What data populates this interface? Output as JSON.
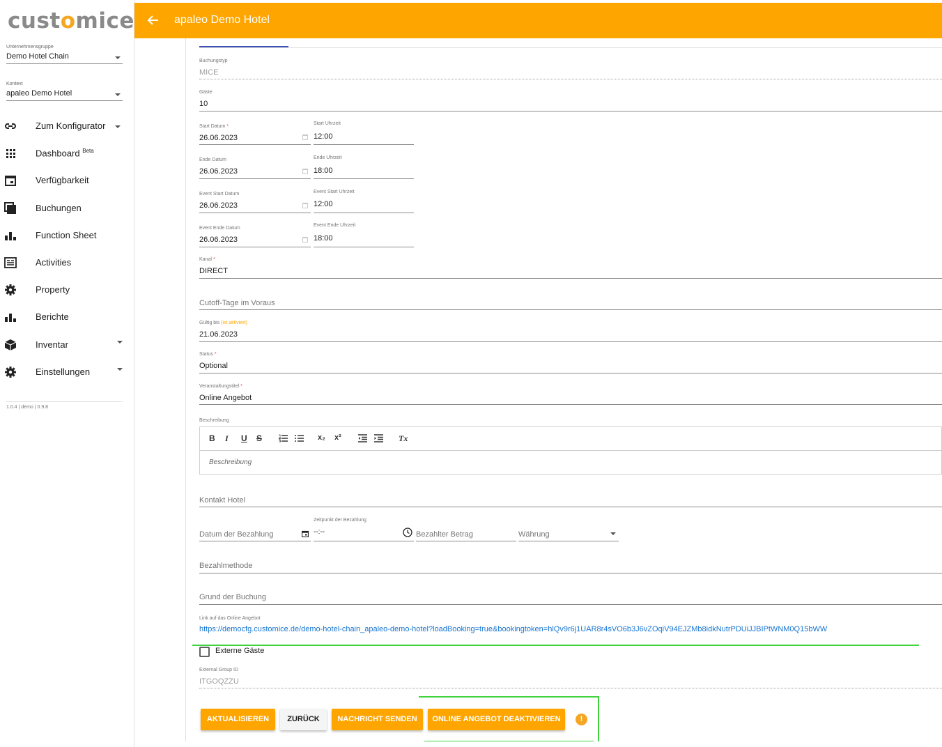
{
  "sidebar": {
    "logo_left": "cust",
    "logo_accent": "o",
    "logo_right": "mice",
    "company_group": {
      "label": "Unternehmensgruppe",
      "value": "Demo Hotel Chain"
    },
    "context": {
      "label": "Kontext",
      "value": "apaleo Demo Hotel"
    },
    "nav": [
      {
        "label": "Zum Konfigurator",
        "icon": "link-icon",
        "has_caret": true
      },
      {
        "label": "Dashboard",
        "sup": "Beta",
        "icon": "grid-icon"
      },
      {
        "label": "Verfügbarkeit",
        "icon": "calendar-icon"
      },
      {
        "label": "Buchungen",
        "icon": "stack-icon"
      },
      {
        "label": "Function Sheet",
        "icon": "bar-chart-icon"
      },
      {
        "label": "Activities",
        "icon": "newspaper-icon"
      },
      {
        "label": "Property",
        "icon": "gear-icon"
      },
      {
        "label": "Berichte",
        "icon": "bar-chart-icon"
      },
      {
        "label": "Inventar",
        "icon": "cube-icon",
        "has_caret": true
      },
      {
        "label": "Einstellungen",
        "icon": "gear-icon",
        "has_caret": true
      }
    ],
    "version": "1.0.4 | demo | 0.9.8"
  },
  "header": {
    "title": "apaleo Demo Hotel"
  },
  "form": {
    "buchungstyp": {
      "label": "Buchungstyp",
      "value": "MICE"
    },
    "gaeste": {
      "label": "Gäste",
      "value": "10"
    },
    "start_datum": {
      "label": "Start Datum",
      "value": "26.06.2023"
    },
    "start_uhrzeit": {
      "label": "Start Uhrzeit",
      "value": "12:00"
    },
    "ende_datum": {
      "label": "Ende Datum",
      "value": "26.06.2023"
    },
    "ende_uhrzeit": {
      "label": "Ende Uhrzeit",
      "value": "18:00"
    },
    "event_start_datum": {
      "label": "Event Start Datum",
      "value": "26.06.2023"
    },
    "event_start_uhrzeit": {
      "label": "Event Start Uhrzeit",
      "value": "12:00"
    },
    "event_ende_datum": {
      "label": "Event Ende Datum",
      "value": "26.06.2023"
    },
    "event_ende_uhrzeit": {
      "label": "Event Ende Uhrzeit",
      "value": "18:00"
    },
    "kanal": {
      "label": "Kanal",
      "value": "DIRECT"
    },
    "cutoff": {
      "placeholder": "Cutoff-Tage im Voraus"
    },
    "gueltig_bis": {
      "label": "Gültig bis",
      "note": "(ist aktiviert)",
      "value": "21.06.2023"
    },
    "status": {
      "label": "Status",
      "value": "Optional"
    },
    "veranstaltungstitel": {
      "label": "Veranstaltungstitel",
      "value": "Online Angebot"
    },
    "beschreibung": {
      "label": "Beschreibung",
      "placeholder": "Beschreibung"
    },
    "kontakt_hotel": {
      "placeholder": "Kontakt Hotel"
    },
    "datum_bezahlung": {
      "placeholder": "Datum der Bezahlung"
    },
    "zeitpunkt_bezahlung": {
      "label": "Zeitpunkt der Bezahlung",
      "value": "--:--"
    },
    "bezahlter_betrag": {
      "placeholder": "Bezahlter Betrag"
    },
    "waehrung": {
      "placeholder": "Währung"
    },
    "bezahlmethode": {
      "placeholder": "Bezahlmethode"
    },
    "grund_buchung": {
      "placeholder": "Grund der Buchung"
    },
    "online_link": {
      "label": "Link auf das Online Angebot",
      "url": "https://democfg.customice.de/demo-hotel-chain_apaleo-demo-hotel?loadBooking=true&bookingtoken=hlQv9r6j1UAR8r4sVO6b3J6vZOqiV94EJZMb8idkNutrPDUiJJBIPtWNM0Q15bWW"
    },
    "externe_gaeste": {
      "label": "Externe Gäste",
      "checked": false
    },
    "external_group_id": {
      "label": "External Group ID",
      "value": "ITGOQZZU"
    },
    "required_mark": "*"
  },
  "editor_toolbar": {
    "bold": "B",
    "italic": "I",
    "underline": "U",
    "strike": "S",
    "subscript": "x₂",
    "superscript": "x²",
    "clear": "Tx"
  },
  "actions": {
    "aktualisieren": "AKTUALISIEREN",
    "zurueck": "ZURÜCK",
    "nachricht": "NACHRICHT SENDEN",
    "deaktivieren": "ONLINE ANGEBOT DEAKTIVIEREN",
    "info": "!"
  },
  "colors": {
    "accent": "#ffa500",
    "link": "#1976d2",
    "highlight": "#3fd43f"
  }
}
